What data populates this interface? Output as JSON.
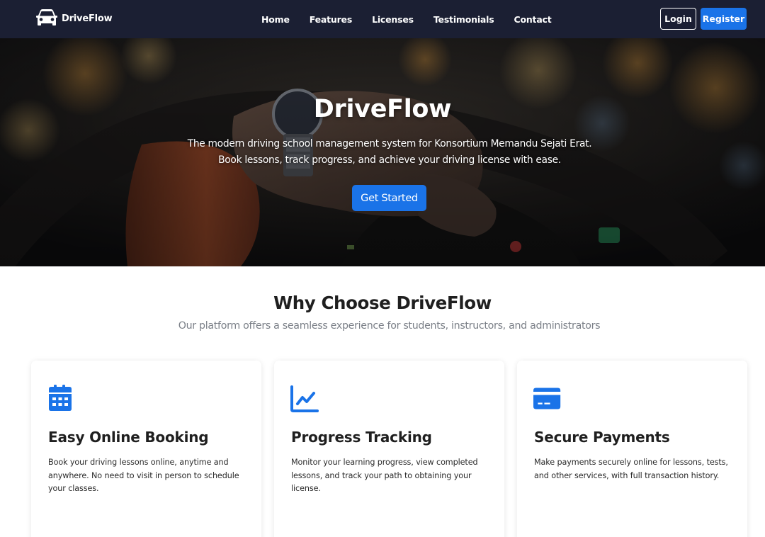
{
  "navbar": {
    "brand": "DriveFlow",
    "brand_icon": "car-icon",
    "links": [
      "Home",
      "Features",
      "Licenses",
      "Testimonials",
      "Contact"
    ],
    "login_label": "Login",
    "register_label": "Register"
  },
  "hero": {
    "title": "DriveFlow",
    "description": "The modern driving school management system for Konsortium Memandu Sejati Erat. Book lessons, track progress, and achieve your driving license with ease.",
    "cta_label": "Get Started"
  },
  "features": {
    "title": "Why Choose DriveFlow",
    "subtitle": "Our platform offers a seamless experience for students, instructors, and administrators",
    "cards": [
      {
        "icon": "calendar-icon",
        "title": "Easy Online Booking",
        "text": "Book your driving lessons online, anytime and anywhere. No need to visit in person to schedule your classes."
      },
      {
        "icon": "chart-line-icon",
        "title": "Progress Tracking",
        "text": "Monitor your learning progress, view completed lessons, and track your path to obtaining your license."
      },
      {
        "icon": "credit-card-icon",
        "title": "Secure Payments",
        "text": "Make payments securely online for lessons, tests, and other services, with full transaction history."
      }
    ]
  },
  "colors": {
    "navbar_bg": "#1b1f33",
    "primary": "#1a73e8",
    "heading": "#1f1f1f",
    "muted": "#7a7f87"
  }
}
